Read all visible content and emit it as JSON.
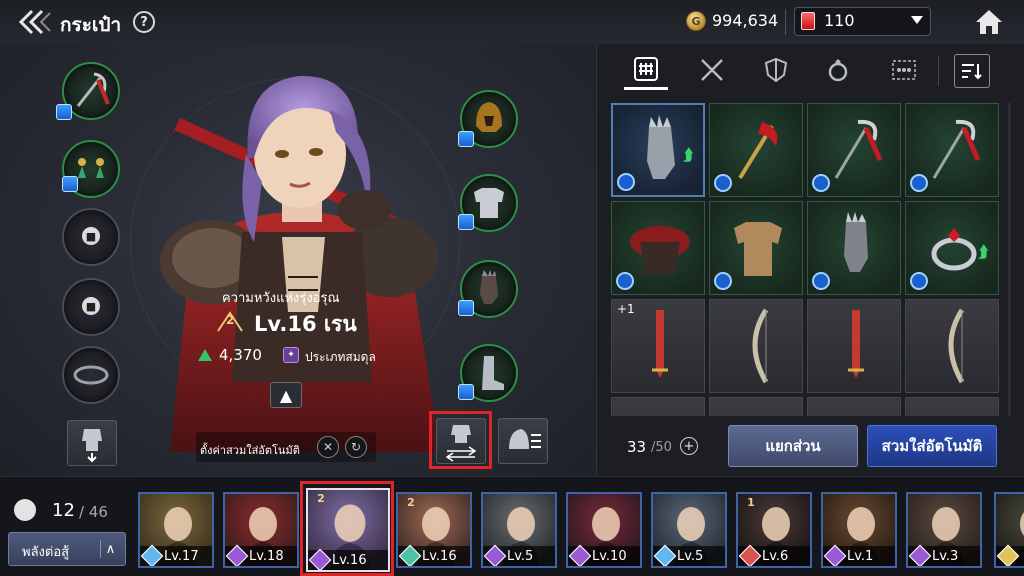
{
  "header": {
    "title": "กระเป๋า",
    "help": "?",
    "gold_symbol": "G",
    "gold": "994,634",
    "gems": "110"
  },
  "character": {
    "name": "ความหวังแห่งรุ่งอรุณ",
    "grade": "2",
    "level": "Lv.16 เรน",
    "power": "4,370",
    "type": "ประเภทสมดุล",
    "auto_equip_setting": "ตั้งค่าสวมใส่อัตโนมัติ"
  },
  "equipment_slots": {
    "left": [
      "weapon",
      "earrings",
      "locked",
      "locked",
      "belt"
    ],
    "right": [
      "helmet",
      "armor",
      "gloves",
      "boots"
    ]
  },
  "tabs": [
    "grid-all",
    "weapons",
    "armor",
    "accessories",
    "more"
  ],
  "inventory": {
    "items": [
      {
        "name": "gauntlet",
        "style": "blue",
        "upgrade": true,
        "plus": ""
      },
      {
        "name": "red-staff",
        "style": "green",
        "upgrade": false,
        "plus": ""
      },
      {
        "name": "scythe-staff",
        "style": "green",
        "upgrade": false,
        "plus": ""
      },
      {
        "name": "scythe-staff",
        "style": "green",
        "upgrade": false,
        "plus": ""
      },
      {
        "name": "red-shoulder-armor",
        "style": "green",
        "upgrade": false,
        "plus": ""
      },
      {
        "name": "leather-tunic",
        "style": "green",
        "upgrade": false,
        "plus": ""
      },
      {
        "name": "steel-gauntlet",
        "style": "green",
        "upgrade": false,
        "plus": ""
      },
      {
        "name": "ruby-ring",
        "style": "green",
        "upgrade": true,
        "plus": ""
      },
      {
        "name": "red-sword",
        "style": "gray",
        "upgrade": false,
        "plus": "+1"
      },
      {
        "name": "bone-bow",
        "style": "gray",
        "upgrade": false,
        "plus": ""
      },
      {
        "name": "red-sword",
        "style": "gray",
        "upgrade": false,
        "plus": ""
      },
      {
        "name": "bone-bow",
        "style": "gray",
        "upgrade": false,
        "plus": ""
      }
    ],
    "count": "33",
    "max": "/50",
    "add": "+"
  },
  "buttons": {
    "split": "แยกส่วน",
    "auto_equip": "สวมใส่อัตโนมัติ",
    "sort": "พลังต่อสู้"
  },
  "party": {
    "count": "12",
    "max": "/ 46",
    "heroes": [
      {
        "level": "Lv.17",
        "grade": "",
        "element": "#5fb8f0",
        "colors": [
          "#7c6a3a",
          "#3a3020"
        ]
      },
      {
        "level": "Lv.18",
        "grade": "",
        "element": "#9a59d6",
        "colors": [
          "#8a2b2b",
          "#3a1c1e"
        ]
      },
      {
        "level": "Lv.16",
        "grade": "2",
        "element": "#9a59d6",
        "colors": [
          "#7d6fa8",
          "#3c2f48"
        ],
        "selected": true
      },
      {
        "level": "Lv.16",
        "grade": "2",
        "element": "#4bc4a5",
        "colors": [
          "#a06b55",
          "#3c2a26"
        ]
      },
      {
        "level": "Lv.5",
        "grade": "",
        "element": "#9a59d6",
        "colors": [
          "#6a6e70",
          "#2a2c2e"
        ]
      },
      {
        "level": "Lv.10",
        "grade": "",
        "element": "#9a59d6",
        "colors": [
          "#7a2a3a",
          "#2a1820"
        ]
      },
      {
        "level": "Lv.5",
        "grade": "",
        "element": "#5fb8f0",
        "colors": [
          "#5a6878",
          "#262c34"
        ]
      },
      {
        "level": "Lv.6",
        "grade": "1",
        "element": "#d9534f",
        "colors": [
          "#4a3a3a",
          "#1c1616"
        ]
      },
      {
        "level": "Lv.1",
        "grade": "",
        "element": "#9a59d6",
        "colors": [
          "#6a4a30",
          "#2a1e14"
        ]
      },
      {
        "level": "Lv.3",
        "grade": "",
        "element": "#9a59d6",
        "colors": [
          "#5a4a40",
          "#2a221c"
        ]
      },
      {
        "level": "",
        "grade": "",
        "element": "#e0c45a",
        "colors": [
          "#4a4a40",
          "#1e1e1a"
        ]
      }
    ]
  }
}
